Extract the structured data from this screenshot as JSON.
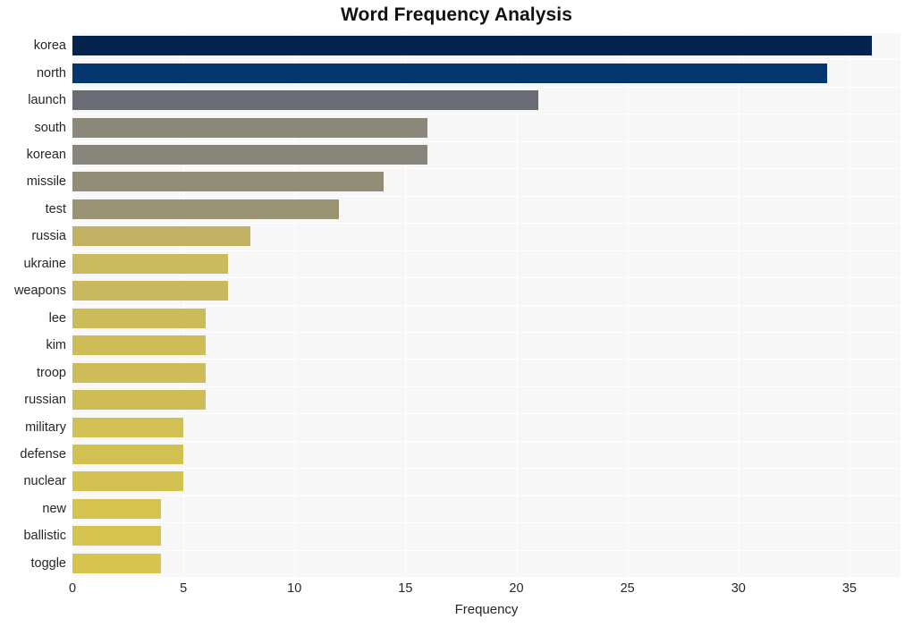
{
  "chart_data": {
    "type": "bar",
    "orientation": "horizontal",
    "title": "Word Frequency Analysis",
    "xlabel": "Frequency",
    "ylabel": "",
    "xlim": [
      0,
      37.3
    ],
    "ylim": [
      0,
      20
    ],
    "grid": true,
    "legend": null,
    "xticks": [
      0,
      5,
      10,
      15,
      20,
      25,
      30,
      35
    ],
    "xtick_labels": [
      "0",
      "5",
      "10",
      "15",
      "20",
      "25",
      "30",
      "35"
    ],
    "categories": [
      "korea",
      "north",
      "launch",
      "south",
      "korean",
      "missile",
      "test",
      "russia",
      "ukraine",
      "weapons",
      "lee",
      "kim",
      "troop",
      "russian",
      "military",
      "defense",
      "nuclear",
      "new",
      "ballistic",
      "toggle"
    ],
    "values": [
      36,
      34,
      21,
      16,
      16,
      14,
      12,
      8,
      7,
      7,
      6,
      6,
      6,
      6,
      5,
      5,
      5,
      4,
      4,
      4
    ],
    "bar_colors": [
      "#04244f",
      "#04356f",
      "#696b75",
      "#8b8879",
      "#88857a",
      "#918d77",
      "#9a9373",
      "#c2b163",
      "#c9b95f",
      "#c8b85f",
      "#ccbb59",
      "#cdbc58",
      "#cdbc57",
      "#cebd56",
      "#d2c054",
      "#d2c053",
      "#d3c152",
      "#d5c34f",
      "#d5c34f",
      "#d6c44e"
    ],
    "plot_background": "#f7f7f7",
    "grid_color": "#ffffff",
    "figure_background": "#ffffff",
    "text_color": "#262626"
  }
}
